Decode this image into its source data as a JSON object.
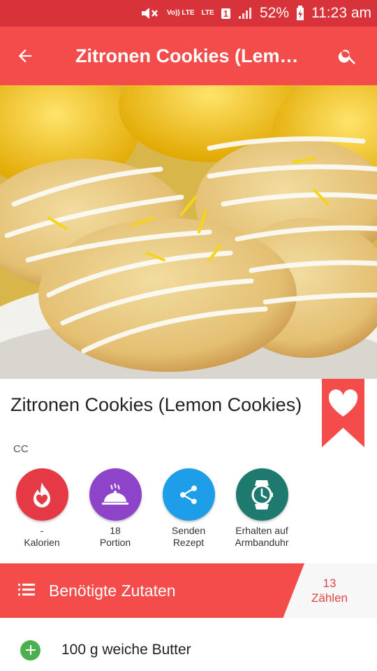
{
  "status_bar": {
    "volte": "Vo)) LTE",
    "lte": "LTE",
    "sim": "1",
    "battery": "52%",
    "time": "11:23 am"
  },
  "appbar": {
    "title": "Zitronen Cookies (Lem…"
  },
  "recipe": {
    "title": "Zitronen Cookies (Lemon Cookies)",
    "source": "CC"
  },
  "actions": [
    {
      "line1": "-",
      "line2": "Kalorien",
      "color": "#e53945",
      "icon": "flame-heart-icon"
    },
    {
      "line1": "18",
      "line2": "Portion",
      "color": "#8e44c9",
      "icon": "serving-cloche-icon"
    },
    {
      "line1": "Senden",
      "line2": "Rezept",
      "color": "#1e9de8",
      "icon": "share-icon"
    },
    {
      "line1": "Erhalten auf",
      "line2": "Armbanduhr",
      "color": "#1e7a6e",
      "icon": "watch-icon"
    }
  ],
  "ingredients_header": {
    "label": "Benötigte Zutaten",
    "count": "13",
    "count_label": "Zählen"
  },
  "ingredients": [
    {
      "text": "100 g weiche Butter"
    }
  ],
  "colors": {
    "status_bar": "#d8323a",
    "app_bar": "#f44b4b",
    "accent": "#f44b4b",
    "plus": "#4caf50"
  }
}
